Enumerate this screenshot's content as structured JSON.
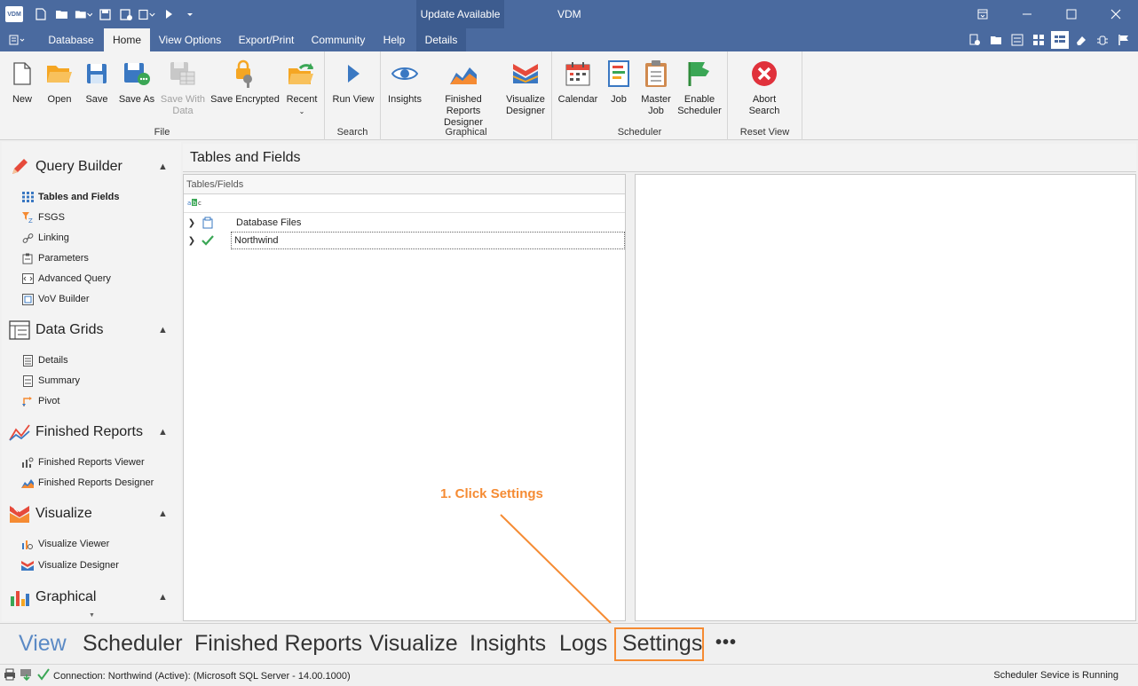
{
  "titlebar": {
    "logo": "VDM",
    "update_label": "Update Available",
    "app_title": "VDM"
  },
  "menu": {
    "tabs": [
      {
        "label": "Database"
      },
      {
        "label": "Home"
      },
      {
        "label": "View Options"
      },
      {
        "label": "Export/Print"
      },
      {
        "label": "Community"
      },
      {
        "label": "Help"
      },
      {
        "label": "Details"
      }
    ]
  },
  "ribbon": {
    "file": {
      "label": "File",
      "new": "New",
      "open": "Open",
      "save": "Save",
      "save_as": "Save As",
      "save_with_data": "Save With Data",
      "save_encrypted": "Save Encrypted",
      "recent": "Recent"
    },
    "search": {
      "label": "Search",
      "run_view": "Run View"
    },
    "graphical": {
      "label": "Graphical",
      "insights": "Insights",
      "finished_reports_designer": "Finished Reports Designer",
      "visualize_designer": "Visualize Designer"
    },
    "scheduler": {
      "label": "Scheduler",
      "calendar": "Calendar",
      "job": "Job",
      "master_job": "Master Job",
      "enable_scheduler": "Enable Scheduler"
    },
    "reset_view": {
      "label": "Reset View",
      "abort_search": "Abort Search"
    }
  },
  "leftnav": {
    "query_builder": {
      "title": "Query Builder",
      "items": [
        "Tables and Fields",
        "FSGS",
        "Linking",
        "Parameters",
        "Advanced Query",
        "VoV Builder"
      ]
    },
    "data_grids": {
      "title": "Data Grids",
      "items": [
        "Details",
        "Summary",
        "Pivot"
      ]
    },
    "finished_reports": {
      "title": "Finished Reports",
      "items": [
        "Finished Reports Viewer",
        "Finished Reports Designer"
      ]
    },
    "visualize": {
      "title": "Visualize",
      "items": [
        "Visualize Viewer",
        "Visualize Designer"
      ]
    },
    "graphical": {
      "title": "Graphical"
    }
  },
  "main": {
    "title": "Tables and Fields",
    "tree_header": "Tables/Fields",
    "filter_icon": "abc-filter-icon",
    "tree": [
      {
        "label": "Database Files"
      },
      {
        "label": "Northwind"
      }
    ]
  },
  "bottomnav": {
    "items": [
      "View",
      "Scheduler",
      "Finished Reports",
      "Visualize",
      "Insights",
      "Logs",
      "Settings"
    ],
    "more": "•••"
  },
  "annotation": {
    "text": "1. Click Settings",
    "color": "#f58b33"
  },
  "status": {
    "connection": "Connection: Northwind (Active):  (Microsoft SQL Server - 14.00.1000)",
    "scheduler": "Scheduler Sevice is Running"
  }
}
